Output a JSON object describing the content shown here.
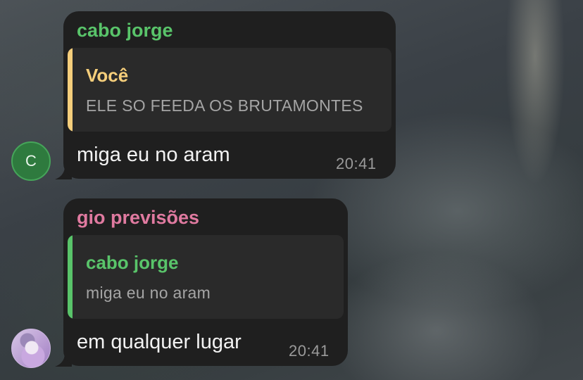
{
  "messages": [
    {
      "sender": "cabo jorge",
      "sender_color": "#59c46a",
      "reply": {
        "name": "Você",
        "name_color": "#f5ce7b",
        "bar_color": "#f5ce7b",
        "text": "ELE SO FEEDA OS BRUTAMONTES"
      },
      "text": "miga eu no aram",
      "time": "20:41",
      "avatar": {
        "initial": "C",
        "color": "#2e7a3e"
      }
    },
    {
      "sender": "gio previsões",
      "sender_color": "#e07aa0",
      "reply": {
        "name": "cabo jorge",
        "name_color": "#59c46a",
        "bar_color": "#59c46a",
        "text": "miga eu no aram"
      },
      "text": "em qualquer lugar",
      "time": "20:41",
      "avatar": {
        "image": "photo-avatar"
      }
    }
  ]
}
